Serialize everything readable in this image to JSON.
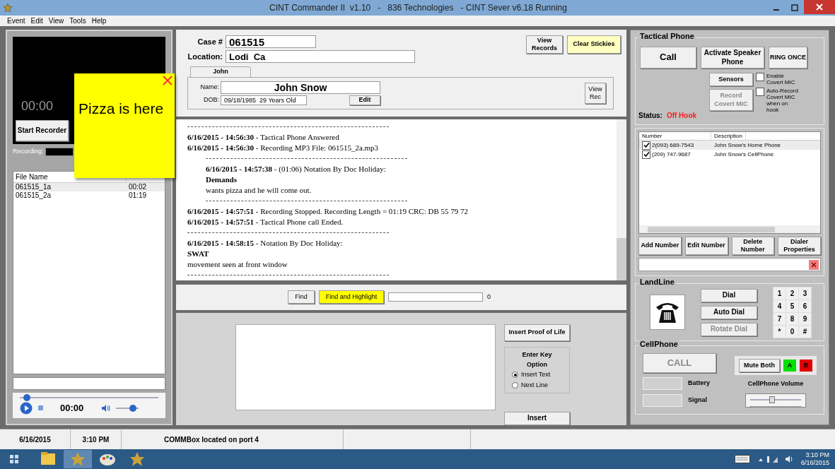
{
  "window": {
    "title": "CINT Commander II  v1.10   -   836 Technologies   - CINT Sever v6.18 Running"
  },
  "menu": [
    "Event",
    "Edit",
    "View",
    "Tools",
    "Help"
  ],
  "recorder": {
    "time": "00:00",
    "start_button": "Start Recorder",
    "recording_label": "Recording:"
  },
  "files": {
    "columns": [
      "File Name"
    ],
    "rows": [
      {
        "cells": [
          "061515_1a",
          "00:02"
        ],
        "selected": true
      },
      {
        "cells": [
          "061515_2a",
          "01:19"
        ],
        "selected": false
      }
    ]
  },
  "player": {
    "time": "00:00",
    "progress": {
      "level": 0.05
    },
    "volume": {
      "level": 0.75
    }
  },
  "sticky": {
    "text": "Pizza is here"
  },
  "case": {
    "case_label": "Case #",
    "case_value": "061515",
    "location_label": "Location:",
    "location_value": "Lodi  Ca",
    "view_records": "View Records",
    "clear_stickies": "Clear Stickies"
  },
  "tabs": [
    {
      "label": "John",
      "selected": true
    }
  ],
  "person": {
    "name_label": "Name:",
    "name": "John Snow",
    "dob_label": "DOB:",
    "dob": "09/18/1985  29 Years Old",
    "edit": "Edit",
    "view_rec": "View Rec"
  },
  "log": [
    {
      "kind": "separator"
    },
    {
      "kind": "entry",
      "text": "**6/16/2015 - 14:56:30** - Tactical Phone Answered"
    },
    {
      "kind": "entry",
      "text": "**6/16/2015 - 14:56:30** - Recording MP3 File: 061515_2a.mp3"
    },
    {
      "kind": "block",
      "children": [
        {
          "kind": "separator"
        },
        {
          "kind": "entry",
          "text": "**6/16/2015 - 14:57:38** - (01:06) Notation By Doc Holiday:"
        },
        {
          "kind": "heading",
          "text": "Demands"
        },
        {
          "kind": "text",
          "text": "wants pizza and he will come out."
        },
        {
          "kind": "separator"
        }
      ]
    },
    {
      "kind": "entry",
      "text": "**6/16/2015 - 14:57:51** - Recording Stopped. Recording Length = 01:19  CRC: DB 55 79 72"
    },
    {
      "kind": "entry",
      "text": "**6/16/2015 - 14:57:51** - Tactical Phone call Ended."
    },
    {
      "kind": "separator"
    },
    {
      "kind": "entry",
      "text": "**6/16/2015 - 14:58:15** - Notation By Doc Holiday:"
    },
    {
      "kind": "heading",
      "text": "SWAT"
    },
    {
      "kind": "text",
      "text": "movement seen at front window"
    },
    {
      "kind": "separator"
    }
  ],
  "find": {
    "find": "Find",
    "find_highlight": "Find and Highlight",
    "count": "0"
  },
  "insert": {
    "proof_of_life": "Insert Proof of Life",
    "option_title": "Enter Key Option",
    "options": [
      {
        "label": "Insert Text",
        "selected": true
      },
      {
        "label": "Next Line",
        "selected": false
      }
    ],
    "insert": "Insert"
  },
  "tactical": {
    "title": "Tactical Phone",
    "call": "Call",
    "speaker": "Activate Speaker Phone",
    "ring": "RING ONCE",
    "sensors": "Sensors",
    "record_covert": {
      "label": "Record Covert MIC",
      "disabled": true
    },
    "options": [
      {
        "label": "Enable Covert MIC",
        "checked": false
      },
      {
        "label": "Auto-Record Covert MIC when on hook",
        "checked": false
      }
    ],
    "status_label": "Status:",
    "status": "Off Hook"
  },
  "numbers": {
    "columns": [
      "Number",
      "Description"
    ],
    "rows": [
      {
        "number": "2(093) 689-7543",
        "description": "John Snow's Home Phone",
        "checked": true,
        "selected": true
      },
      {
        "number": "(209) 747-9687",
        "description": "John Snow's CellPhone",
        "checked": true,
        "selected": false
      }
    ],
    "buttons": [
      "Add Number",
      "Edit Number",
      "Delete Number",
      "Dialer Properties"
    ]
  },
  "landline": {
    "title": "LandLine",
    "buttons": [
      {
        "label": "Dial",
        "disabled": false
      },
      {
        "label": "Auto Dial",
        "disabled": false
      },
      {
        "label": "Rotate Dial",
        "disabled": true
      }
    ],
    "keys": [
      "1",
      "2",
      "3",
      "4",
      "5",
      "6",
      "7",
      "8",
      "9",
      "*",
      "0",
      "#"
    ]
  },
  "cellphone": {
    "title": "CellPhone",
    "call": {
      "label": "CALL",
      "disabled": true
    },
    "mute": "Mute Both",
    "indicators": [
      {
        "label": "A",
        "color": "#00e000"
      },
      {
        "label": "B",
        "color": "#e00000"
      }
    ],
    "battery": "Battery",
    "signal": "Signal",
    "volume_label": "CellPhone Volume",
    "volume": {
      "level": 0.45
    }
  },
  "status_bar": [
    "6/16/2015",
    "3:10 PM",
    "COMMBox located on port 4"
  ],
  "taskbar": {
    "time": "3:10 PM",
    "date": "6/16/2015"
  }
}
